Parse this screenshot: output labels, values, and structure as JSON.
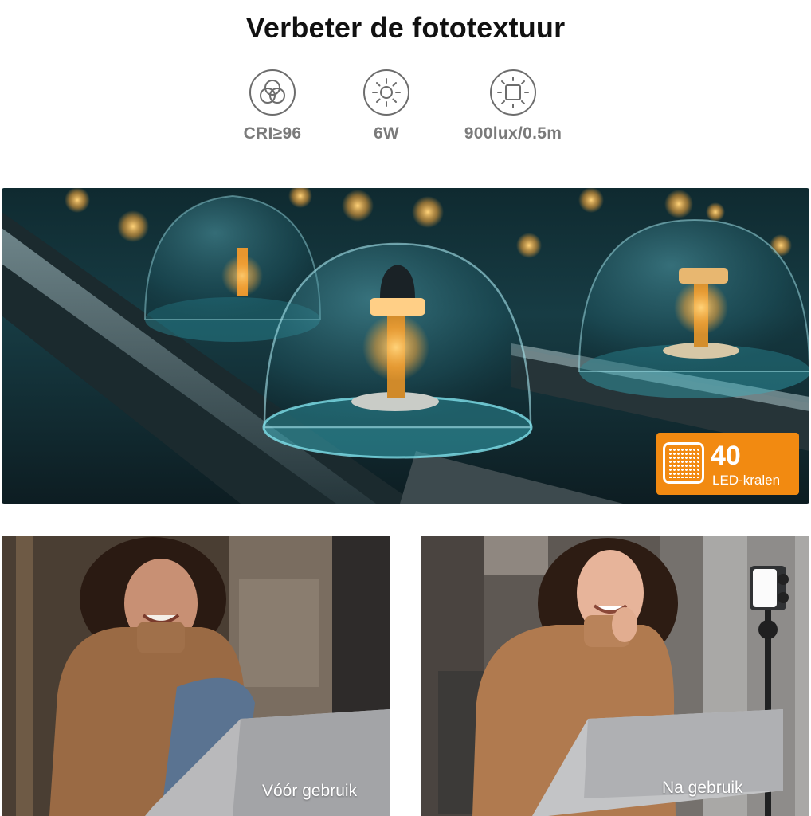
{
  "title": "Verbeter de fototextuur",
  "specs": [
    {
      "icon": "cri-circles-icon",
      "label": "CRI≥96"
    },
    {
      "icon": "sun-icon",
      "label": "6W"
    },
    {
      "icon": "brightness-square-icon",
      "label": "900lux/0.5m"
    }
  ],
  "badge": {
    "icon": "led-grid-icon",
    "number": "40",
    "unit": "LED-kralen",
    "color": "#f28a11"
  },
  "comparison": {
    "before_label": "Vóór gebruik",
    "after_label": "Na gebruik"
  }
}
